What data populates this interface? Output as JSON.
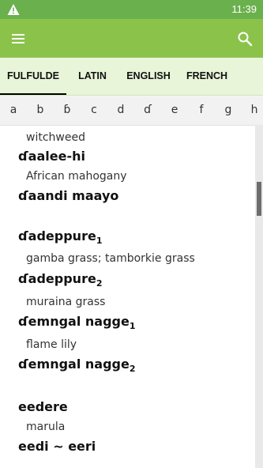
{
  "status_bar": {
    "time": "11:39",
    "warning_icon": "warning-triangle-icon"
  },
  "app_bar": {
    "menu_icon": "hamburger-menu-icon",
    "search_icon": "search-icon"
  },
  "tabs": [
    {
      "label": "FULFULDE",
      "active": true
    },
    {
      "label": "LATIN",
      "active": false
    },
    {
      "label": "ENGLISH",
      "active": false
    },
    {
      "label": "FRENCH",
      "active": false
    }
  ],
  "letters": [
    "a",
    "b",
    "ɓ",
    "c",
    "d",
    "ɗ",
    "e",
    "f",
    "g",
    "h"
  ],
  "entries": [
    {
      "type": "gloss",
      "text": "witchweed"
    },
    {
      "type": "head",
      "text": "ɗaalee-hi",
      "sub": ""
    },
    {
      "type": "gloss",
      "text": "African mahogany"
    },
    {
      "type": "head",
      "text": "ɗaandi maayo",
      "sub": ""
    },
    {
      "type": "head",
      "text": "ɗadeppure",
      "sub": "1"
    },
    {
      "type": "gloss",
      "text": "gamba grass; tamborkie grass"
    },
    {
      "type": "head",
      "text": "ɗadeppure",
      "sub": "2"
    },
    {
      "type": "gloss",
      "text": "muraina grass"
    },
    {
      "type": "head",
      "text": "ɗemngal nagge",
      "sub": "1"
    },
    {
      "type": "gloss",
      "text": "flame lily"
    },
    {
      "type": "head",
      "text": "ɗemngal nagge",
      "sub": "2"
    },
    {
      "type": "head",
      "text": "eedere",
      "sub": ""
    },
    {
      "type": "gloss",
      "text": "marula"
    },
    {
      "type": "head",
      "text": "eedi ~ eeri",
      "sub": ""
    }
  ],
  "scroll_position": 0.17
}
